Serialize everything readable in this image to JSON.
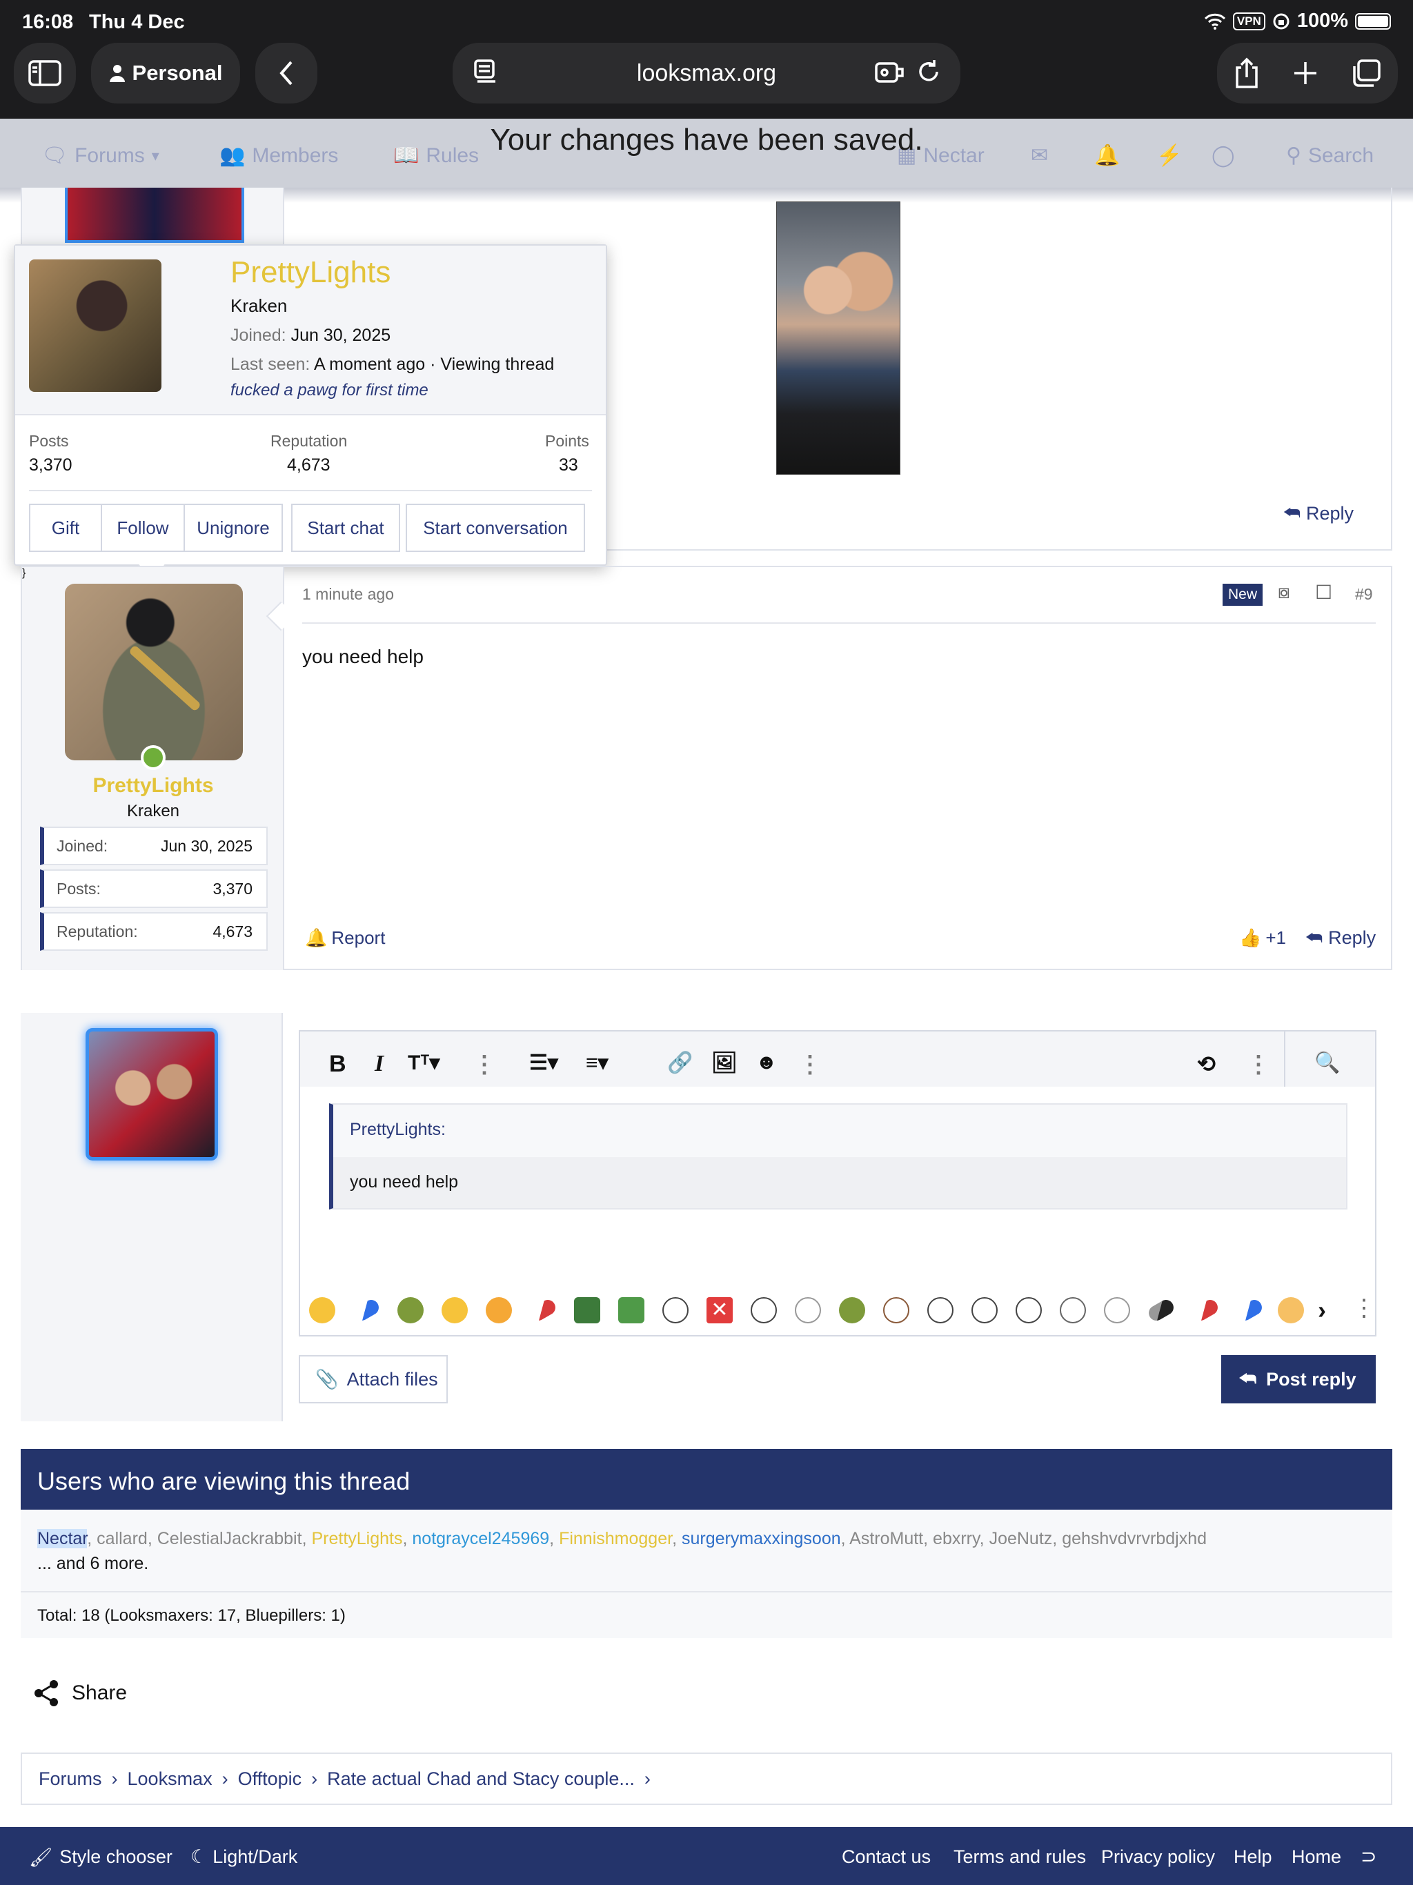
{
  "status": {
    "time": "16:08",
    "date": "Thu 4 Dec",
    "vpn": "VPN",
    "battery": "100%"
  },
  "browser": {
    "profile": "Personal",
    "url": "looksmax.org"
  },
  "nav": {
    "forums": "Forums",
    "members": "Members",
    "rules": "Rules",
    "nectar": "Nectar",
    "search": "Search"
  },
  "toast": "Your changes have been saved.",
  "popup": {
    "name": "PrettyLights",
    "rank": "Kraken",
    "joined_label": "Joined:",
    "joined": "Jun 30, 2025",
    "lastseen_label": "Last seen:",
    "lastseen": "A moment ago · Viewing thread",
    "status": "fucked a pawg for first time",
    "posts_label": "Posts",
    "posts": "3,370",
    "rep_label": "Reputation",
    "rep": "4,673",
    "points_label": "Points",
    "points": "33",
    "buttons": [
      "Gift",
      "Follow",
      "Unignore",
      "Start chat",
      "Start conversation"
    ]
  },
  "prev_post": {
    "reply": "Reply"
  },
  "post": {
    "time": "1 minute ago",
    "badge": "New",
    "number": "#9",
    "body": "you need help",
    "report": "Report",
    "likes": "+1",
    "reply": "Reply",
    "author": "PrettyLights",
    "rank": "Kraken",
    "stats": [
      {
        "k": "Joined:",
        "v": "Jun 30, 2025"
      },
      {
        "k": "Posts:",
        "v": "3,370"
      },
      {
        "k": "Reputation:",
        "v": "4,673"
      }
    ]
  },
  "editor": {
    "quote_author": "PrettyLights:",
    "quote_body": "you need help",
    "attach": "Attach files",
    "post_reply": "Post reply"
  },
  "viewers": {
    "title": "Users who are viewing this thread",
    "users": [
      {
        "name": "Nectar",
        "color": "#2b3a7a"
      },
      {
        "name": "callard",
        "color": "#888888"
      },
      {
        "name": "CelestialJackrabbit",
        "color": "#888888"
      },
      {
        "name": "PrettyLights",
        "color": "#e3c33a"
      },
      {
        "name": "notgraycel245969",
        "color": "#2f97d8"
      },
      {
        "name": "Finnishmogger",
        "color": "#e3c33a"
      },
      {
        "name": "surgerymaxxingsoon",
        "color": "#2f6fc8"
      },
      {
        "name": "AstroMutt",
        "color": "#888888"
      },
      {
        "name": "ebxrry",
        "color": "#888888"
      },
      {
        "name": "JoeNutz",
        "color": "#888888"
      },
      {
        "name": "gehshvdvrvrbdjxhd",
        "color": "#888888"
      }
    ],
    "more": "... and 6 more.",
    "total": "Total: 18 (Looksmaxers: 17, Bluepillers: 1)"
  },
  "share": "Share",
  "breadcrumbs": [
    "Forums",
    "Looksmax",
    "Offtopic",
    "Rate actual Chad and Stacy couple..."
  ],
  "footer": {
    "style": "Style chooser",
    "light": "Light/Dark",
    "links": [
      "Contact us",
      "Terms and rules",
      "Privacy policy",
      "Help",
      "Home"
    ]
  }
}
